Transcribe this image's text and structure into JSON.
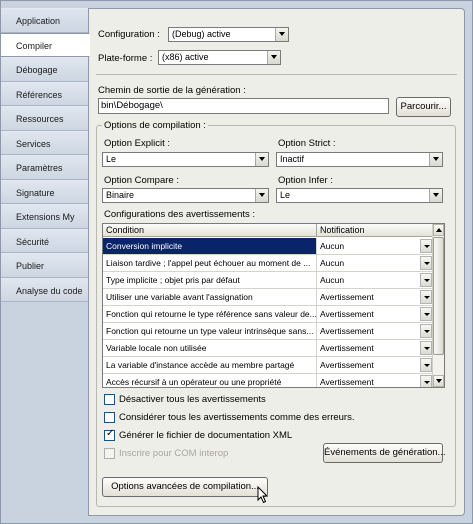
{
  "sidebar": {
    "items": [
      {
        "label": "Application"
      },
      {
        "label": "Compiler"
      },
      {
        "label": "Débogage"
      },
      {
        "label": "Références"
      },
      {
        "label": "Ressources"
      },
      {
        "label": "Services"
      },
      {
        "label": "Paramètres"
      },
      {
        "label": "Signature"
      },
      {
        "label": "Extensions My"
      },
      {
        "label": "Sécurité"
      },
      {
        "label": "Publier"
      },
      {
        "label": "Analyse du code"
      }
    ],
    "active": "Compiler"
  },
  "top": {
    "configuration_label": "Configuration :",
    "configuration_value": "(Debug) active",
    "platform_label": "Plate-forme :",
    "platform_value": "(x86) active"
  },
  "output": {
    "label": "Chemin de sortie de la génération :",
    "value": "bin\\Débogage\\",
    "browse_label": "Parcourir..."
  },
  "options": {
    "group_title": "Options de compilation :",
    "explicit_label": "Option Explicit :",
    "explicit_value": "Le",
    "strict_label": "Option Strict :",
    "strict_value": "Inactif",
    "compare_label": "Option Compare :",
    "compare_value": "Binaire",
    "infer_label": "Option Infer :",
    "infer_value": "Le",
    "warnings_label": "Configurations des avertissements :"
  },
  "grid": {
    "columns": [
      "Condition",
      "Notification"
    ],
    "rows": [
      {
        "condition": "Conversion implicite",
        "notification": "Aucun"
      },
      {
        "condition": "Liaison tardive ; l'appel peut échouer au moment de ...",
        "notification": "Aucun"
      },
      {
        "condition": "Type implicite ; objet pris par défaut",
        "notification": "Aucun"
      },
      {
        "condition": "Utiliser une variable avant l'assignation",
        "notification": "Avertissement"
      },
      {
        "condition": "Fonction qui retourne le type référence sans valeur de...",
        "notification": "Avertissement"
      },
      {
        "condition": "Fonction qui retourne un type valeur intrinsèque sans...",
        "notification": "Avertissement"
      },
      {
        "condition": "Variable locale non utilisée",
        "notification": "Avertissement"
      },
      {
        "condition": "La variable d'instance accède au membre partagé",
        "notification": "Avertissement"
      },
      {
        "condition": "Accès récursif à un opérateur ou une propriété",
        "notification": "Avertissement"
      }
    ]
  },
  "checkboxes": {
    "disable_all": {
      "label": "Désactiver tous les avertissements",
      "checked": false
    },
    "treat_as_errors": {
      "label": "Considérer tous les avertissements comme des erreurs.",
      "checked": false
    },
    "xml_doc": {
      "label": "Générer le fichier de documentation XML",
      "checked": true
    },
    "com_interop": {
      "label": "Inscrire pour COM interop",
      "checked": false,
      "disabled": true
    }
  },
  "buttons": {
    "build_events": "Événements de génération...",
    "advanced": "Options avancées de compilation..."
  },
  "colors": {
    "selection": "#0a246a",
    "panel": "#eeeee8",
    "sidebar": "#c9d3e0"
  }
}
